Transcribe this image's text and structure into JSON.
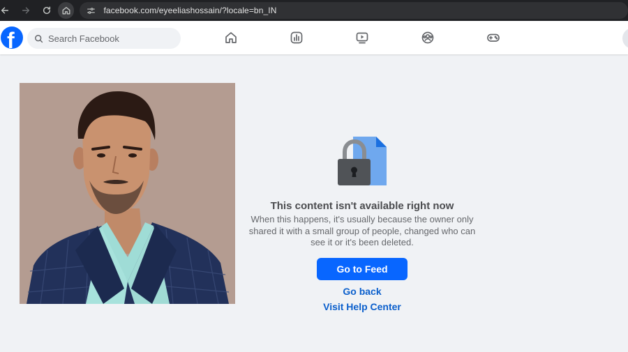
{
  "browser": {
    "url": "facebook.com/eyeeliashossain/?locale=bn_IN",
    "nav_icons": [
      "back-arrow-icon",
      "forward-arrow-icon",
      "reload-icon",
      "home-icon",
      "site-info-icon"
    ]
  },
  "header": {
    "logo": "f",
    "search": {
      "placeholder": "Search Facebook",
      "value": ""
    },
    "nav_items": [
      "home-icon",
      "dashboard-icon",
      "video-icon",
      "groups-icon",
      "gaming-icon"
    ]
  },
  "message": {
    "title": "This content isn't available right now",
    "body": "When this happens, it's usually because the owner only shared it with a small group of people, changed who can see it or it's been deleted.",
    "primary_button": "Go to Feed",
    "back_link": "Go back",
    "help_link": "Visit Help Center"
  },
  "colors": {
    "brand": "#0866ff",
    "link": "#0b5fcc",
    "page_bg": "#f0f2f5",
    "browser_bar": "#202124"
  }
}
